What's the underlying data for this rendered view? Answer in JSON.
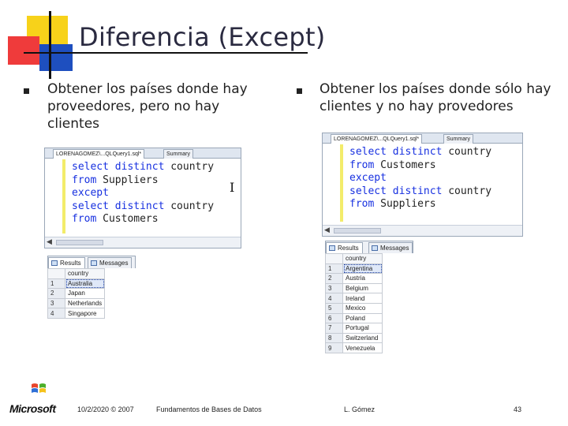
{
  "title": "Diferencia (Except)",
  "left": {
    "bullet": "Obtener los países donde hay proveedores, pero no hay clientes",
    "editor": {
      "tab_label": "LORENAGOMEZ\\...QLQuery1.sql*",
      "summary_tab": "Summary",
      "lines": [
        [
          {
            "t": "select distinct ",
            "k": true
          },
          {
            "t": "country",
            "k": false
          }
        ],
        [
          {
            "t": "from ",
            "k": true
          },
          {
            "t": "Suppliers",
            "k": false
          }
        ],
        [
          {
            "t": "except",
            "k": true
          }
        ],
        [
          {
            "t": "select distinct ",
            "k": true
          },
          {
            "t": "country",
            "k": false
          }
        ],
        [
          {
            "t": "from ",
            "k": true
          },
          {
            "t": "Customers",
            "k": false
          }
        ]
      ]
    },
    "results": {
      "results_tab": "Results",
      "messages_tab": "Messages",
      "column": "country",
      "rows": [
        {
          "n": "1",
          "v": "Australia"
        },
        {
          "n": "2",
          "v": "Japan"
        },
        {
          "n": "3",
          "v": "Netherlands"
        },
        {
          "n": "4",
          "v": "Singapore"
        }
      ]
    }
  },
  "right": {
    "bullet": "Obtener los países donde sólo hay clientes y no hay provedores",
    "editor": {
      "tab_label": "LORENAGOMEZ\\...QLQuery1.sql*",
      "summary_tab": "Summary",
      "lines": [
        [
          {
            "t": "select distinct ",
            "k": true
          },
          {
            "t": "country",
            "k": false
          }
        ],
        [
          {
            "t": "from ",
            "k": true
          },
          {
            "t": "Customers",
            "k": false
          }
        ],
        [
          {
            "t": "except",
            "k": true
          }
        ],
        [
          {
            "t": "select distinct ",
            "k": true
          },
          {
            "t": "country",
            "k": false
          }
        ],
        [
          {
            "t": "from ",
            "k": true
          },
          {
            "t": "Suppliers",
            "k": false
          }
        ]
      ]
    },
    "results": {
      "results_tab": "Results",
      "messages_tab": "Messages",
      "column": "country",
      "rows": [
        {
          "n": "1",
          "v": "Argentina"
        },
        {
          "n": "2",
          "v": "Austria"
        },
        {
          "n": "3",
          "v": "Belgium"
        },
        {
          "n": "4",
          "v": "Ireland"
        },
        {
          "n": "5",
          "v": "Mexico"
        },
        {
          "n": "6",
          "v": "Poland"
        },
        {
          "n": "7",
          "v": "Portugal"
        },
        {
          "n": "8",
          "v": "Switzerland"
        },
        {
          "n": "9",
          "v": "Venezuela"
        }
      ]
    }
  },
  "footer": {
    "logo": "Microsoft",
    "date": "10/2/2020 © 2007",
    "course": "Fundamentos de Bases de Datos",
    "author": "L. Gómez",
    "page": "43"
  },
  "colors": {
    "keyword": "#1730e0",
    "accent_yellow": "#f7d21a",
    "accent_red": "#ef3b3b",
    "accent_blue": "#1e4fbf"
  }
}
